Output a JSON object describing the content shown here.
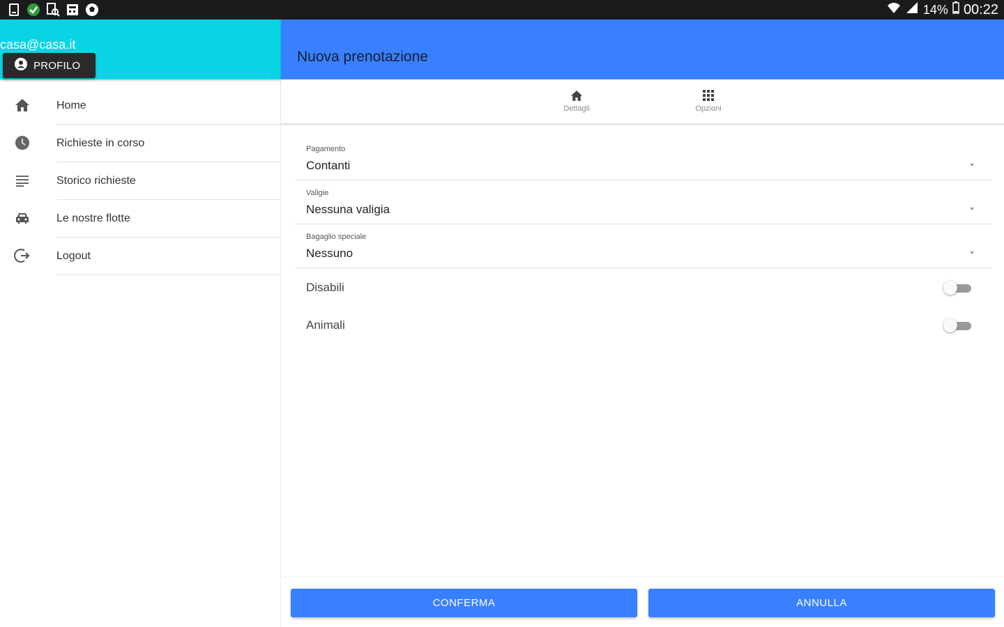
{
  "status_bar": {
    "wifi_icon": "wifi-icon",
    "signal_icon": "signal-icon",
    "battery": "14%",
    "time": "00:22"
  },
  "drawer": {
    "email": "casa@casa.it",
    "profile_label": "PROFILO",
    "items": [
      {
        "label": "Home",
        "icon": "home-icon"
      },
      {
        "label": "Richieste in corso",
        "icon": "clock-icon"
      },
      {
        "label": "Storico richieste",
        "icon": "list-icon"
      },
      {
        "label": "Le nostre flotte",
        "icon": "car-icon"
      },
      {
        "label": "Logout",
        "icon": "logout-icon"
      }
    ]
  },
  "header": {
    "title": "Nuova prenotazione"
  },
  "tabs": [
    {
      "label": "Dettagli",
      "icon": "home-icon"
    },
    {
      "label": "Opzioni",
      "icon": "grid-icon"
    }
  ],
  "form": {
    "payment": {
      "label": "Pagamento",
      "value": "Contanti"
    },
    "luggage": {
      "label": "Valigie",
      "value": "Nessuna valigia"
    },
    "special_luggage": {
      "label": "Bagaglio speciale",
      "value": "Nessuno"
    },
    "disabled": {
      "label": "Disabili",
      "checked": false
    },
    "animals": {
      "label": "Animali",
      "checked": false
    }
  },
  "footer": {
    "confirm_label": "CONFERMA",
    "cancel_label": "ANNULLA"
  },
  "colors": {
    "toolbar": "#3880ff",
    "drawer_header": "#08d4e4",
    "profile_button": "#2a2a2a"
  }
}
